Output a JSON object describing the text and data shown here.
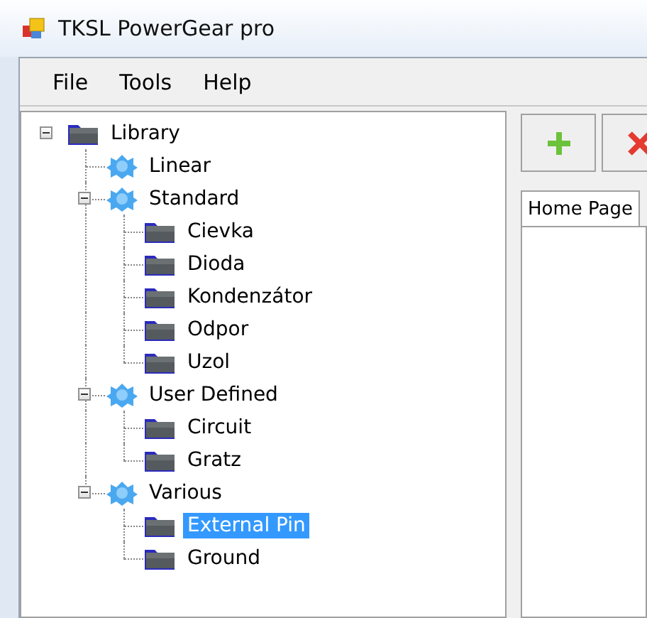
{
  "window": {
    "title": "TKSL PowerGear pro"
  },
  "menu": [
    "File",
    "Tools",
    "Help"
  ],
  "tree": [
    {
      "label": "Library",
      "kind": "folder",
      "expanded": true,
      "selected": false,
      "children": [
        {
          "label": "Linear",
          "kind": "group",
          "selected": false
        },
        {
          "label": "Standard",
          "kind": "group",
          "expanded": true,
          "selected": false,
          "children": [
            {
              "label": "Cievka",
              "kind": "folder",
              "selected": false
            },
            {
              "label": "Dioda",
              "kind": "folder",
              "selected": false
            },
            {
              "label": "Kondenzátor",
              "kind": "folder",
              "selected": false
            },
            {
              "label": "Odpor",
              "kind": "folder",
              "selected": false
            },
            {
              "label": "Uzol",
              "kind": "folder",
              "selected": false
            }
          ]
        },
        {
          "label": "User Defined",
          "kind": "group",
          "expanded": true,
          "selected": false,
          "children": [
            {
              "label": "Circuit",
              "kind": "folder",
              "selected": false
            },
            {
              "label": "Gratz",
              "kind": "folder",
              "selected": false
            }
          ]
        },
        {
          "label": "Various",
          "kind": "group",
          "expanded": true,
          "selected": false,
          "children": [
            {
              "label": "External Pin",
              "kind": "folder",
              "selected": true
            },
            {
              "label": "Ground",
              "kind": "folder",
              "selected": false
            }
          ]
        }
      ]
    }
  ],
  "toolbar": [
    {
      "kind": "add"
    },
    {
      "kind": "delete"
    }
  ],
  "tabs": [
    {
      "label": "Home Page",
      "selected": true
    }
  ]
}
